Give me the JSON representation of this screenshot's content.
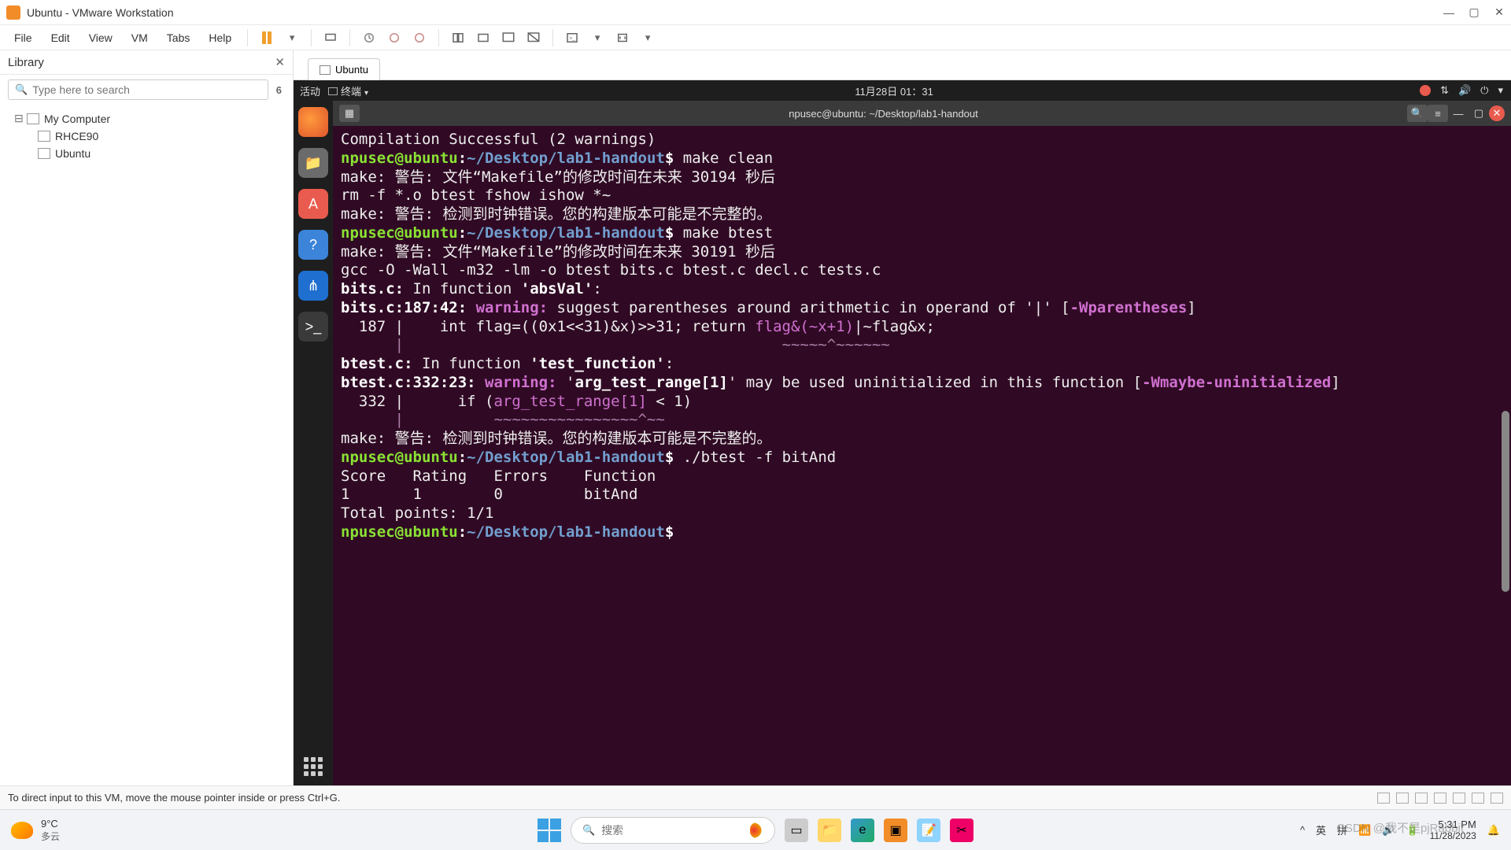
{
  "window": {
    "title": "Ubuntu - VMware Workstation"
  },
  "menus": [
    "File",
    "Edit",
    "View",
    "VM",
    "Tabs",
    "Help"
  ],
  "library": {
    "title": "Library",
    "search_placeholder": "Type here to search",
    "result_count": "6",
    "nodes": {
      "root": "My Computer",
      "children": [
        "RHCE90",
        "Ubuntu"
      ]
    }
  },
  "vm_tabs": {
    "home_icon": "home",
    "active": "Ubuntu"
  },
  "ubuntu_top": {
    "activities": "活动",
    "app_indicator": "终端",
    "datetime": "11月28日 01：31"
  },
  "dock": [
    "firefox",
    "files",
    "software",
    "help",
    "vscode",
    "terminal"
  ],
  "terminal": {
    "title": "npusec@ubuntu: ~/Desktop/lab1-handout",
    "prompt_user": "npusec@ubuntu",
    "prompt_path": "~/Desktop/lab1-handout",
    "lines": {
      "l1": "Compilation Successful (2 warnings)",
      "cmd1": "make clean",
      "warn1": "make: 警告: 文件“Makefile”的修改时间在未来 30194 秒后",
      "rm": "rm -f *.o btest fshow ishow *~",
      "warn2": "make: 警告: 检测到时钟错误。您的构建版本可能是不完整的。",
      "cmd2": "make btest",
      "warn3": "make: 警告: 文件“Makefile”的修改时间在未来 30191 秒后",
      "gcc": "gcc -O -Wall -m32 -lm -o btest bits.c btest.c decl.c tests.c",
      "bits_fn": "bits.c:",
      "bits_fn_txt": " In function ",
      "bits_fn_name": "'absVal'",
      "bits_fn_colon": ":",
      "bits_loc": "bits.c:187:42: ",
      "warn_lbl": "warning: ",
      "bits_msg": "suggest parentheses around arithmetic in operand of '|' [",
      "wparen": "-Wparentheses",
      "bracket": "]",
      "src187a": "  187 |    int flag=((0x1<<31)&x)>>31; return ",
      "src187b": "flag&(~x+1)",
      "src187c": "|~flag&x;",
      "src187u": "      |                                          ~~~~~^~~~~~~",
      "btest_fn": "btest.c:",
      "btest_fn_txt": " In function ",
      "btest_fn_name": "'test_function'",
      "btest_loc": "btest.c:332:23: ",
      "btest_msg1": "'",
      "btest_arg": "arg_test_range[1]",
      "btest_msg2": "' may be used uninitialized in this function [",
      "wmaybe": "-Wmaybe-uninitialized",
      "src332a": "  332 |      if (",
      "src332b": "arg_test_range[1]",
      "src332c": " < 1)",
      "src332u": "      |          ~~~~~~~~~~~~~~~~^~~",
      "warn4": "make: 警告: 检测到时钟错误。您的构建版本可能是不完整的。",
      "cmd3": "./btest -f bitAnd",
      "hdr": "Score   Rating   Errors    Function",
      "row": "1       1        0         bitAnd",
      "total": "Total points: 1/1"
    }
  },
  "statusbar": {
    "hint": "To direct input to this VM, move the mouse pointer inside or press Ctrl+G."
  },
  "taskbar": {
    "weather_temp": "9°C",
    "weather_desc": "多云",
    "search_placeholder": "搜索",
    "ime1": "英",
    "ime2": "拼",
    "time": "5:31 PM",
    "date": "11/28/2023"
  },
  "watermark": "CSDN @我不是pjRabbit",
  "tray_up": "^"
}
